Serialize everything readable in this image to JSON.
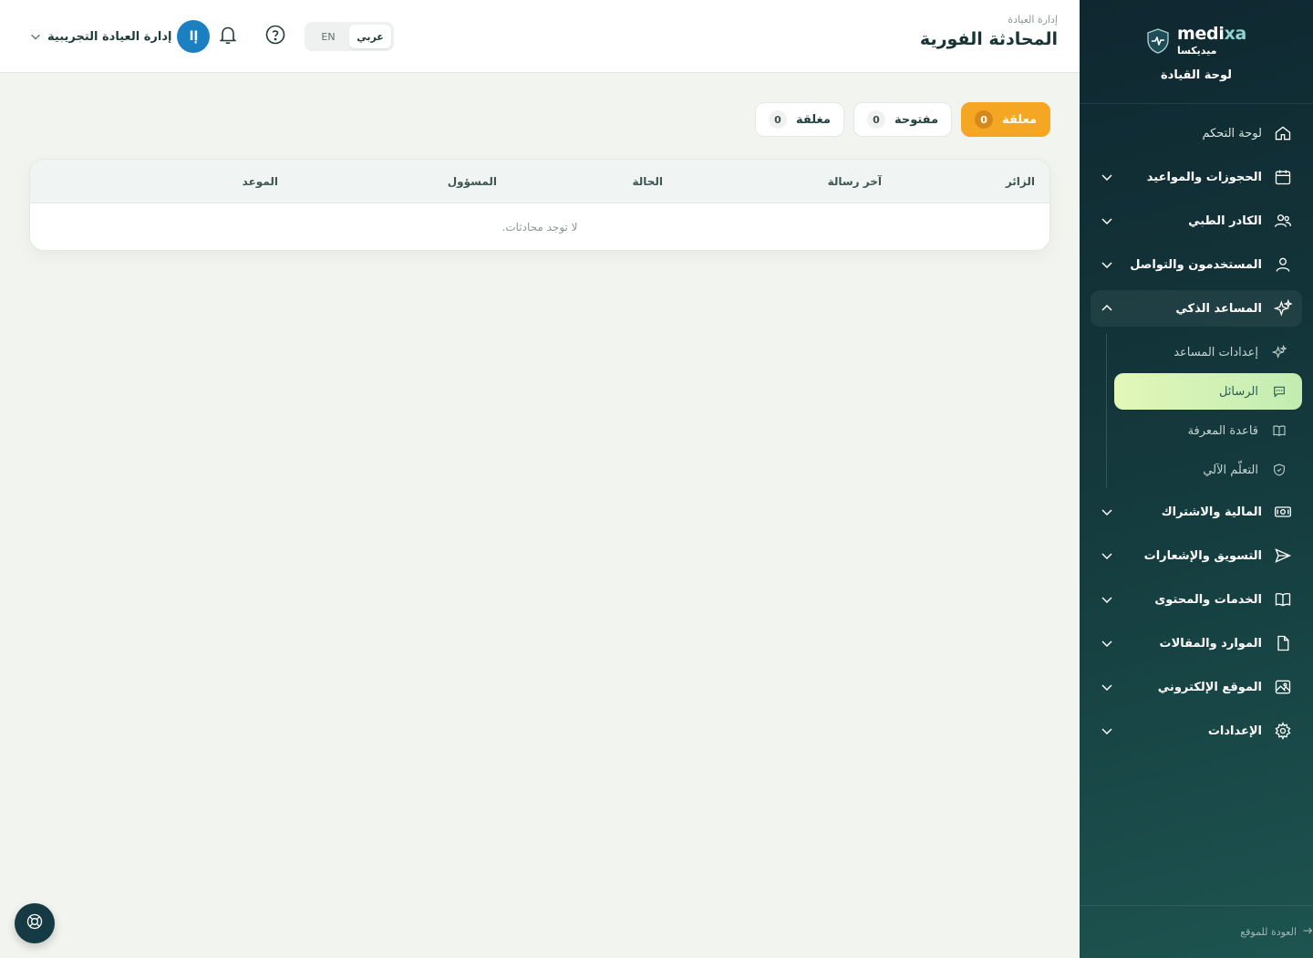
{
  "brand": {
    "latin_prefix": "medi",
    "latin_suffix": "xa",
    "arabic": "ميديكسا",
    "subtitle": "لوحة القيادة"
  },
  "sidebar": {
    "items": [
      {
        "label": "لوحة التحكم",
        "icon": "home-icon"
      },
      {
        "label": "الحجوزات والمواعيد",
        "icon": "calendar-icon"
      },
      {
        "label": "الكادر الطبي",
        "icon": "users-icon"
      },
      {
        "label": "المستخدمون والتواصل",
        "icon": "user-icon"
      },
      {
        "label": "المساعد الذكي",
        "icon": "sparkles-icon"
      },
      {
        "label": "المالية والاشتراك",
        "icon": "money-icon"
      },
      {
        "label": "التسويق والإشعارات",
        "icon": "send-icon"
      },
      {
        "label": "الخدمات والمحتوى",
        "icon": "book-icon"
      },
      {
        "label": "الموارد والمقالات",
        "icon": "file-icon"
      },
      {
        "label": "الموقع الإلكتروني",
        "icon": "image-icon"
      },
      {
        "label": "الإعدادات",
        "icon": "gear-icon"
      }
    ],
    "submenu": [
      {
        "label": "إعدادات المساعد",
        "icon": "sparkles-icon"
      },
      {
        "label": "الرسائل",
        "icon": "message-icon",
        "active": true
      },
      {
        "label": "قاعدة المعرفة",
        "icon": "book-icon"
      },
      {
        "label": "التعلّم الآلي",
        "icon": "shield-icon"
      }
    ],
    "footer_link": "العودة للموقع"
  },
  "header": {
    "breadcrumb": "إدارة العيادة",
    "title": "المحادثة الفورية",
    "user_name": "إدارة العيادة التجريبية",
    "avatar_initials": "إا",
    "lang_ar": "عربي",
    "lang_en": "EN"
  },
  "tabs": [
    {
      "label": "معلقة",
      "count": "0",
      "active": true
    },
    {
      "label": "مفتوحة",
      "count": "0"
    },
    {
      "label": "مغلقة",
      "count": "0"
    }
  ],
  "table": {
    "columns": [
      "الزائر",
      "آخر رسالة",
      "الحالة",
      "المسؤول",
      "الموعد"
    ],
    "empty_text": "لا توجد محادثات."
  },
  "colors": {
    "accent": "#f5a623",
    "sidebar": "#143a3d",
    "active_sub": "#c2ecb2",
    "avatar": "#1c7fc0"
  }
}
